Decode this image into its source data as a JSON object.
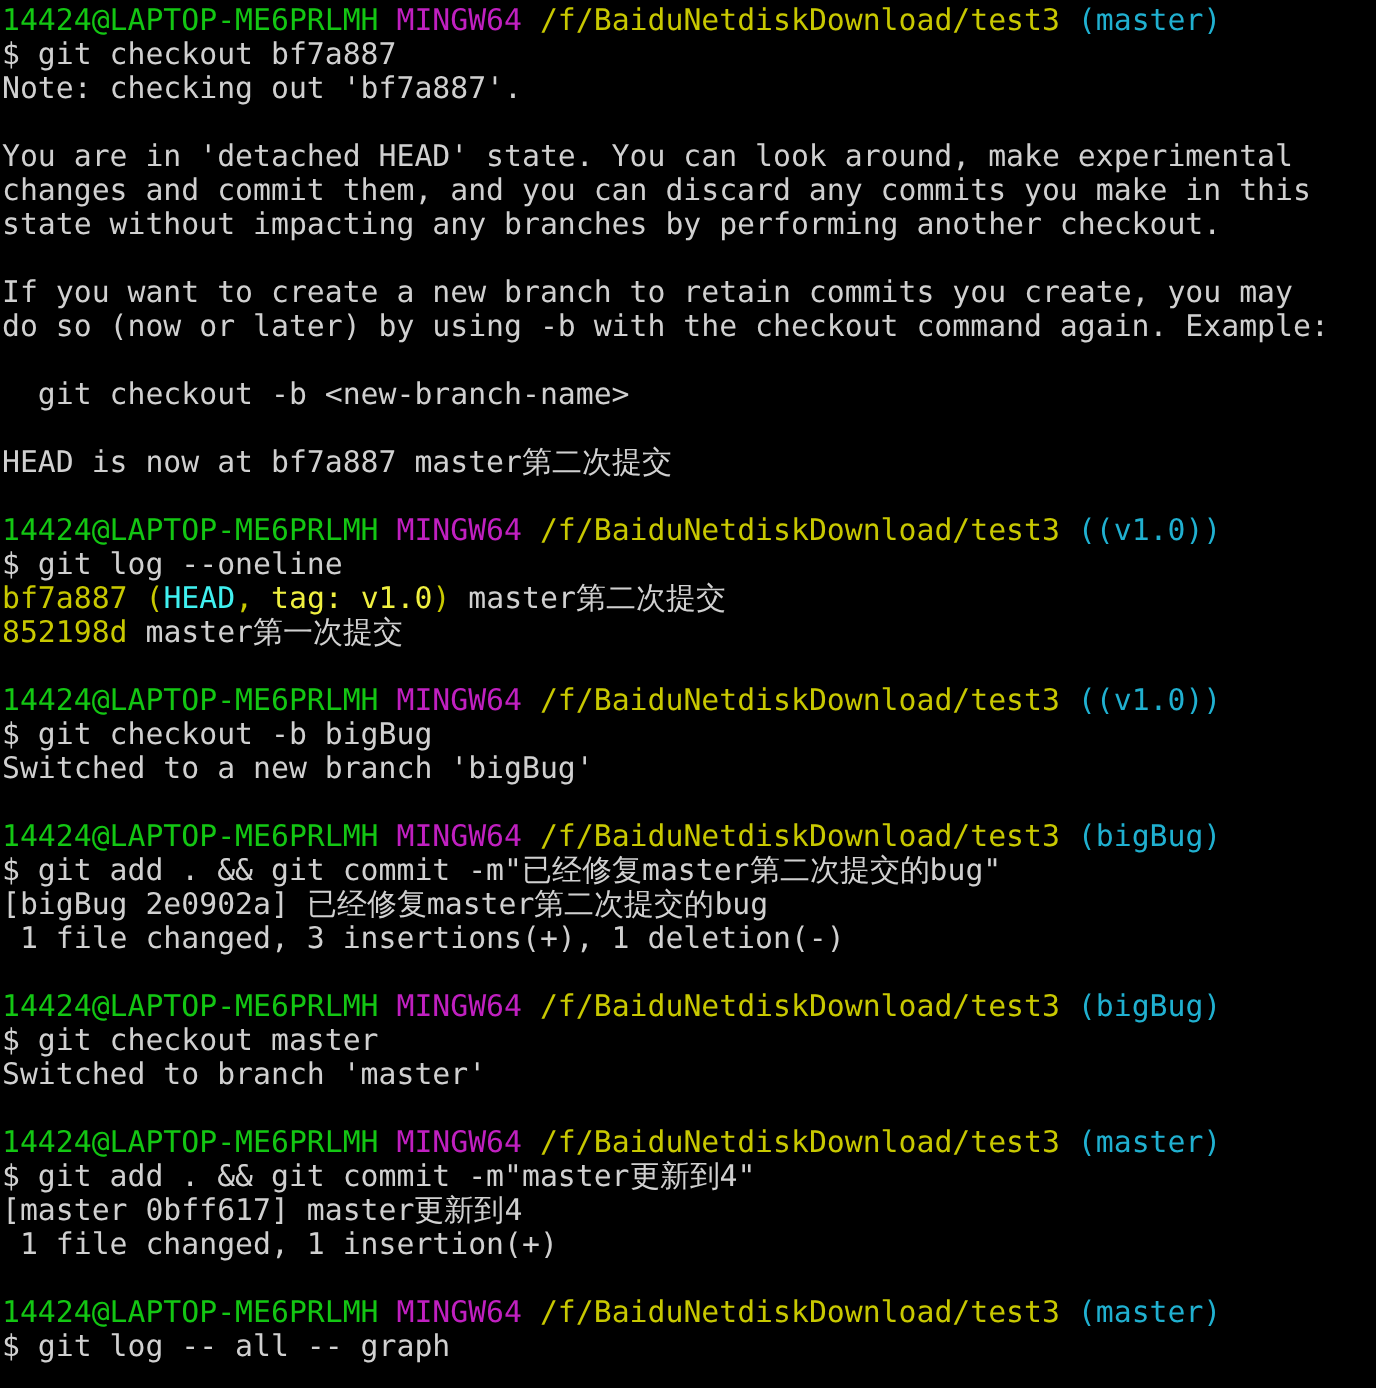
{
  "lines": [
    {
      "kind": "text",
      "segments": [
        {
          "text": "14424@LAPTOP-ME6PRLMH",
          "color": "#13c613"
        },
        {
          "text": "MINGW64",
          "color": "#c020c0"
        },
        {
          "text": "/f/BaiduNetdiskDownload/test3",
          "color": "#c8c800"
        },
        {
          "text": "(master)",
          "color": "#20b0d0"
        }
      ]
    },
    {
      "kind": "text",
      "segments": [
        {
          "text": "$ git checkout bf7a887",
          "color": "#d0d0d0"
        }
      ]
    },
    {
      "kind": "text",
      "segments": [
        {
          "text": "Note: checking out 'bf7a887'.",
          "color": "#d0d0d0"
        }
      ]
    },
    {
      "kind": "blank"
    },
    {
      "kind": "text",
      "segments": [
        {
          "text": "You are in 'detached HEAD' state. You can look around, make experimental",
          "color": "#d0d0d0"
        }
      ]
    },
    {
      "kind": "text",
      "segments": [
        {
          "text": "changes and commit them, and you can discard any commits you make in this",
          "color": "#d0d0d0"
        }
      ]
    },
    {
      "kind": "text",
      "segments": [
        {
          "text": "state without impacting any branches by performing another checkout.",
          "color": "#d0d0d0"
        }
      ]
    },
    {
      "kind": "blank"
    },
    {
      "kind": "text",
      "segments": [
        {
          "text": "If you want to create a new branch to retain commits you create, you may",
          "color": "#d0d0d0"
        }
      ]
    },
    {
      "kind": "text",
      "segments": [
        {
          "text": "do so (now or later) by using -b with the checkout command again. Example:",
          "color": "#d0d0d0"
        }
      ]
    },
    {
      "kind": "blank"
    },
    {
      "kind": "text",
      "segments": [
        {
          "text": "  git checkout -b <new-branch-name>",
          "color": "#d0d0d0"
        }
      ]
    },
    {
      "kind": "blank"
    },
    {
      "kind": "text",
      "segments": [
        {
          "text": "HEAD is now at bf7a887 master第二次提交",
          "color": "#d0d0d0"
        }
      ]
    },
    {
      "kind": "blank"
    },
    {
      "kind": "text",
      "segments": [
        {
          "text": "14424@LAPTOP-ME6PRLMH",
          "color": "#13c613"
        },
        {
          "text": "MINGW64",
          "color": "#c020c0"
        },
        {
          "text": "/f/BaiduNetdiskDownload/test3",
          "color": "#c8c800"
        },
        {
          "text": "((v1.0))",
          "color": "#20b0d0"
        }
      ]
    },
    {
      "kind": "text",
      "segments": [
        {
          "text": "$ git log --oneline",
          "color": "#d0d0d0"
        }
      ]
    },
    {
      "kind": "text",
      "segments": [
        {
          "text": "bf7a887",
          "color": "#c8c800"
        },
        {
          "text": "(",
          "color": "#c8c800"
        },
        {
          "text": "HEAD",
          "color": "#40f0f0",
          "attached": true
        },
        {
          "text": ",",
          "color": "#c8c800",
          "attached": true
        },
        {
          "text": "tag: v1.0",
          "color": "#f0f040"
        },
        {
          "text": ")",
          "color": "#c8c800",
          "attached": true
        },
        {
          "text": "master第二次提交",
          "color": "#d0d0d0"
        }
      ]
    },
    {
      "kind": "text",
      "segments": [
        {
          "text": "852198d",
          "color": "#c8c800"
        },
        {
          "text": "master第一次提交",
          "color": "#d0d0d0"
        }
      ]
    },
    {
      "kind": "blank"
    },
    {
      "kind": "text",
      "segments": [
        {
          "text": "14424@LAPTOP-ME6PRLMH",
          "color": "#13c613"
        },
        {
          "text": "MINGW64",
          "color": "#c020c0"
        },
        {
          "text": "/f/BaiduNetdiskDownload/test3",
          "color": "#c8c800"
        },
        {
          "text": "((v1.0))",
          "color": "#20b0d0"
        }
      ]
    },
    {
      "kind": "text",
      "segments": [
        {
          "text": "$ git checkout -b bigBug",
          "color": "#d0d0d0"
        }
      ]
    },
    {
      "kind": "text",
      "segments": [
        {
          "text": "Switched to a new branch 'bigBug'",
          "color": "#d0d0d0"
        }
      ]
    },
    {
      "kind": "blank"
    },
    {
      "kind": "text",
      "segments": [
        {
          "text": "14424@LAPTOP-ME6PRLMH",
          "color": "#13c613"
        },
        {
          "text": "MINGW64",
          "color": "#c020c0"
        },
        {
          "text": "/f/BaiduNetdiskDownload/test3",
          "color": "#c8c800"
        },
        {
          "text": "(bigBug)",
          "color": "#20b0d0"
        }
      ]
    },
    {
      "kind": "text",
      "segments": [
        {
          "text": "$ git add . && git commit -m\"已经修复master第二次提交的bug\"",
          "color": "#d0d0d0"
        }
      ]
    },
    {
      "kind": "text",
      "segments": [
        {
          "text": "[bigBug 2e0902a] 已经修复master第二次提交的bug",
          "color": "#d0d0d0"
        }
      ]
    },
    {
      "kind": "text",
      "segments": [
        {
          "text": " 1 file changed, 3 insertions(+), 1 deletion(-)",
          "color": "#d0d0d0"
        }
      ]
    },
    {
      "kind": "blank"
    },
    {
      "kind": "text",
      "segments": [
        {
          "text": "14424@LAPTOP-ME6PRLMH",
          "color": "#13c613"
        },
        {
          "text": "MINGW64",
          "color": "#c020c0"
        },
        {
          "text": "/f/BaiduNetdiskDownload/test3",
          "color": "#c8c800"
        },
        {
          "text": "(bigBug)",
          "color": "#20b0d0"
        }
      ]
    },
    {
      "kind": "text",
      "segments": [
        {
          "text": "$ git checkout master",
          "color": "#d0d0d0"
        }
      ]
    },
    {
      "kind": "text",
      "segments": [
        {
          "text": "Switched to branch 'master'",
          "color": "#d0d0d0"
        }
      ]
    },
    {
      "kind": "blank"
    },
    {
      "kind": "text",
      "segments": [
        {
          "text": "14424@LAPTOP-ME6PRLMH",
          "color": "#13c613"
        },
        {
          "text": "MINGW64",
          "color": "#c020c0"
        },
        {
          "text": "/f/BaiduNetdiskDownload/test3",
          "color": "#c8c800"
        },
        {
          "text": "(master)",
          "color": "#20b0d0"
        }
      ]
    },
    {
      "kind": "text",
      "segments": [
        {
          "text": "$ git add . && git commit -m\"master更新到4\"",
          "color": "#d0d0d0"
        }
      ]
    },
    {
      "kind": "text",
      "segments": [
        {
          "text": "[master 0bff617] master更新到4",
          "color": "#d0d0d0"
        }
      ]
    },
    {
      "kind": "text",
      "segments": [
        {
          "text": " 1 file changed, 1 insertion(+)",
          "color": "#d0d0d0"
        }
      ]
    },
    {
      "kind": "blank"
    },
    {
      "kind": "text",
      "segments": [
        {
          "text": "14424@LAPTOP-ME6PRLMH",
          "color": "#13c613"
        },
        {
          "text": "MINGW64",
          "color": "#c020c0"
        },
        {
          "text": "/f/BaiduNetdiskDownload/test3",
          "color": "#c8c800"
        },
        {
          "text": "(master)",
          "color": "#20b0d0"
        }
      ]
    },
    {
      "kind": "text",
      "segments": [
        {
          "text": "$ git log -- all -- graph",
          "color": "#d0d0d0"
        }
      ]
    }
  ]
}
